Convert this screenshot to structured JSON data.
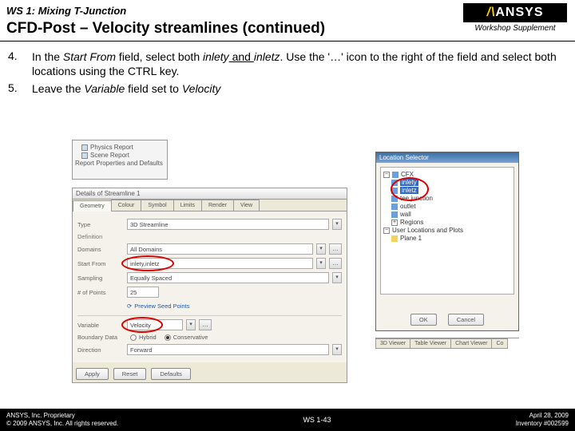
{
  "header": {
    "ws_title": "WS 1: Mixing T-Junction",
    "main_title": "CFD-Post – Velocity streamlines (continued)",
    "supplement": "Workshop Supplement",
    "logo_text": "ANSYS"
  },
  "steps": [
    {
      "num": "4.",
      "pre": "In the ",
      "em1": "Start From",
      "mid1": " field, select both ",
      "em2": "inlety",
      "and": " and ",
      "em3": "inletz",
      "post": ".  Use the '…' icon to the right of the field and select both locations using the CTRL key."
    },
    {
      "num": "5.",
      "pre": "Leave the ",
      "em1": "Variable",
      "mid1": " field set to ",
      "em2": "Velocity",
      "and": "",
      "em3": "",
      "post": ""
    }
  ],
  "tree": {
    "items": [
      "Physics Report",
      "Scene Report",
      "Report Properties and Defaults"
    ]
  },
  "details": {
    "title": "Details of Streamline 1",
    "tabs": [
      "Geometry",
      "Colour",
      "Symbol",
      "Limits",
      "Render",
      "View"
    ],
    "type_label": "Type",
    "type_value": "3D Streamline",
    "definition": "Definition",
    "domains_label": "Domains",
    "domains_value": "All Domains",
    "startfrom_label": "Start From",
    "startfrom_value": "inlety,inletz",
    "sampling_label": "Sampling",
    "sampling_value": "Equally Spaced",
    "numpts_label": "# of Points",
    "numpts_value": "25",
    "preview": "Preview Seed Points",
    "variable_label": "Variable",
    "variable_value": "Velocity",
    "bd_label": "Boundary Data",
    "hybrid": "Hybrid",
    "conservative": "Conservative",
    "direction_label": "Direction",
    "direction_value": "Forward",
    "apply": "Apply",
    "reset": "Reset",
    "defaults": "Defaults"
  },
  "loc": {
    "title": "Location Selector",
    "root": "CFX",
    "items": [
      "inlety",
      "inletz",
      "tee junction",
      "outlet",
      "wall"
    ],
    "regions": "Regions",
    "user": "User Locations and Plots",
    "plane": "Plane 1",
    "ok": "OK",
    "cancel": "Cancel",
    "bottom_tabs": [
      "3D Viewer",
      "Table Viewer",
      "Chart Viewer",
      "Co"
    ]
  },
  "footer": {
    "left1": "ANSYS, Inc. Proprietary",
    "left2": "© 2009 ANSYS, Inc. All rights reserved.",
    "center": "WS 1-43",
    "right1": "April 28, 2009",
    "right2": "Inventory #002599"
  }
}
